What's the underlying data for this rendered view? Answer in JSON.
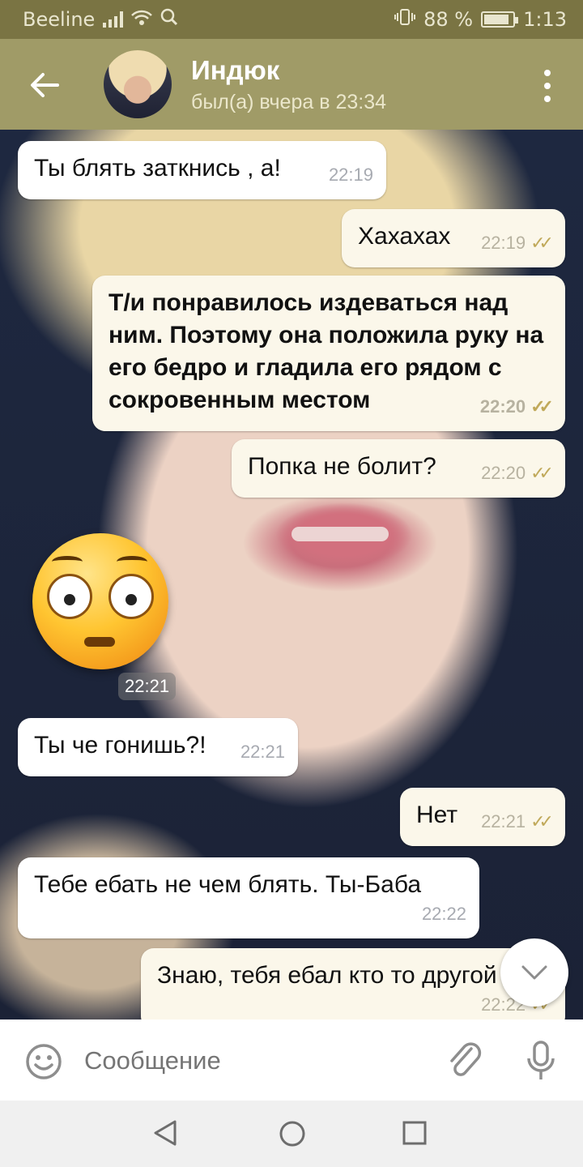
{
  "status_bar": {
    "carrier": "Beeline",
    "battery": "88 %",
    "battery_level": 0.88,
    "time": "1:13"
  },
  "header": {
    "name": "Индюк",
    "status": "был(а) вчера в 23:34"
  },
  "messages": [
    {
      "dir": "in",
      "text": "Ты блять заткнись , а!",
      "time": "22:19"
    },
    {
      "dir": "out",
      "text": "Хахахах",
      "time": "22:19",
      "read": true
    },
    {
      "dir": "out",
      "text": "Т/и понравилось издеваться над ним. Поэтому она положила руку на его бедро и гладила его рядом с сокровенным местом",
      "time": "22:20",
      "read": true
    },
    {
      "dir": "out",
      "text": "Попка не болит?",
      "time": "22:20",
      "read": true
    },
    {
      "dir": "in",
      "sticker": "flushed-face-emoji",
      "time": "22:21"
    },
    {
      "dir": "in",
      "text": "Ты че гонишь?!",
      "time": "22:21"
    },
    {
      "dir": "out",
      "text": "Нет",
      "time": "22:21",
      "read": true
    },
    {
      "dir": "in",
      "text": "Тебе ебать не чем блять. Ты-Баба",
      "time": "22:22"
    },
    {
      "dir": "out",
      "text": "Знаю, тебя ебал кто то другой",
      "time": "22:22",
      "read": true
    }
  ],
  "input": {
    "placeholder": "Сообщение"
  },
  "colors": {
    "status_bar": "#7a7443",
    "header": "#a09b67",
    "outgoing_bubble": "#fbf7ea",
    "incoming_bubble": "#ffffff",
    "read_tick": "#c0a95a"
  }
}
